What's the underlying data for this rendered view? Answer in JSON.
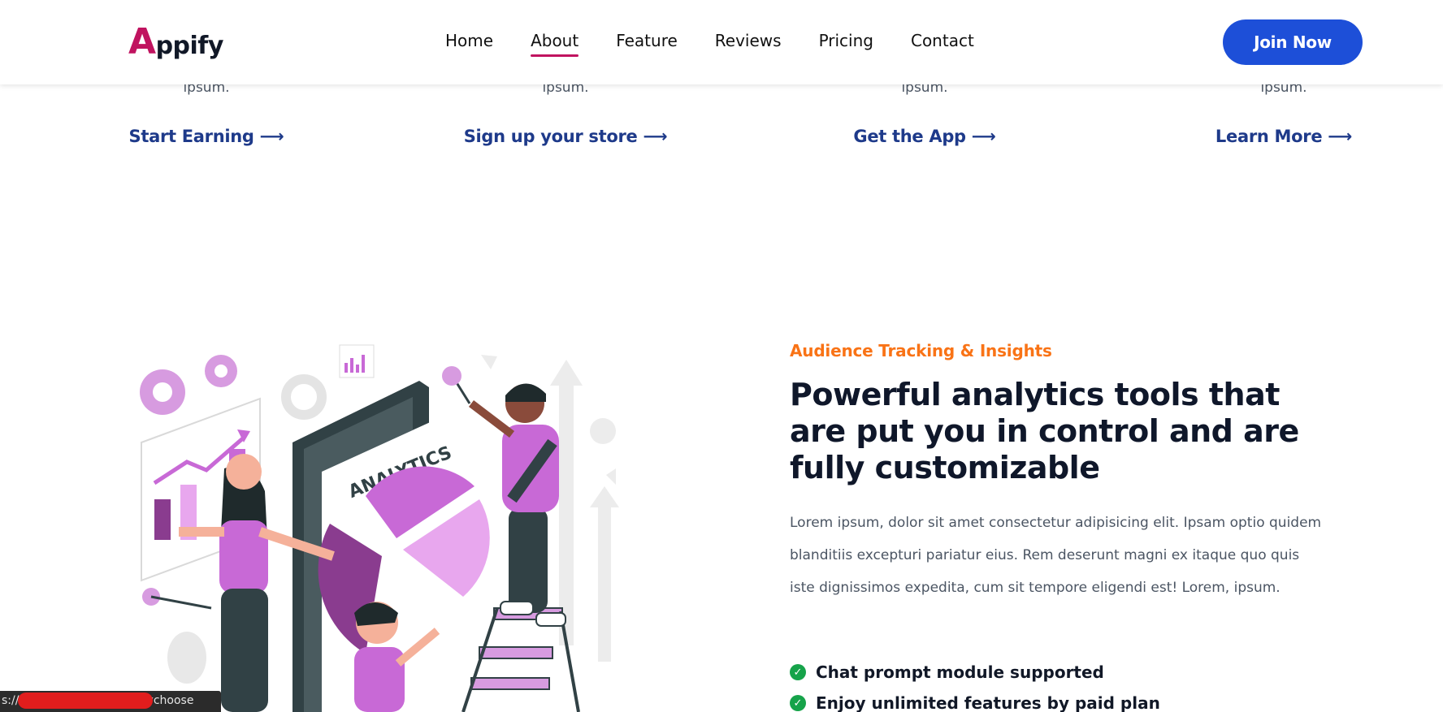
{
  "brand": {
    "first_letter": "A",
    "rest": "ppify"
  },
  "nav": {
    "items": [
      "Home",
      "About",
      "Feature",
      "Reviews",
      "Pricing",
      "Contact"
    ],
    "active": "About",
    "cta": "Join Now"
  },
  "cards": [
    {
      "tail_text": "ipsum.",
      "link": "Start Earning ⟶"
    },
    {
      "tail_text": "ipsum.",
      "link": "Sign up your store ⟶"
    },
    {
      "tail_text": "ipsum.",
      "link": "Get the App ⟶"
    },
    {
      "tail_text": "ipsum.",
      "link": "Learn More ⟶"
    }
  ],
  "section": {
    "eyebrow": "Audience Tracking & Insights",
    "headline": "Powerful analytics tools that are put you in control and are fully customizable",
    "paragraph": "Lorem ipsum, dolor sit amet consectetur adipisicing elit. Ipsam optio quidem blanditiis excepturi pariatur eius. Rem deserunt magni ex itaque quo quis iste dignissimos expedita, cum sit tempore eligendi est! Lorem, ipsum.",
    "features": [
      "Chat prompt module supported",
      "Enjoy unlimited features by paid plan"
    ],
    "illustration_label": "ANALYTICS"
  },
  "status_bar": {
    "url": "s://ua-appify.ve..app/#whychoose"
  },
  "colors": {
    "brand": "#c0135f",
    "cta": "#1d4fd8",
    "eyebrow": "#f97316",
    "link": "#1e3a8a",
    "accent": "#c869d6"
  }
}
